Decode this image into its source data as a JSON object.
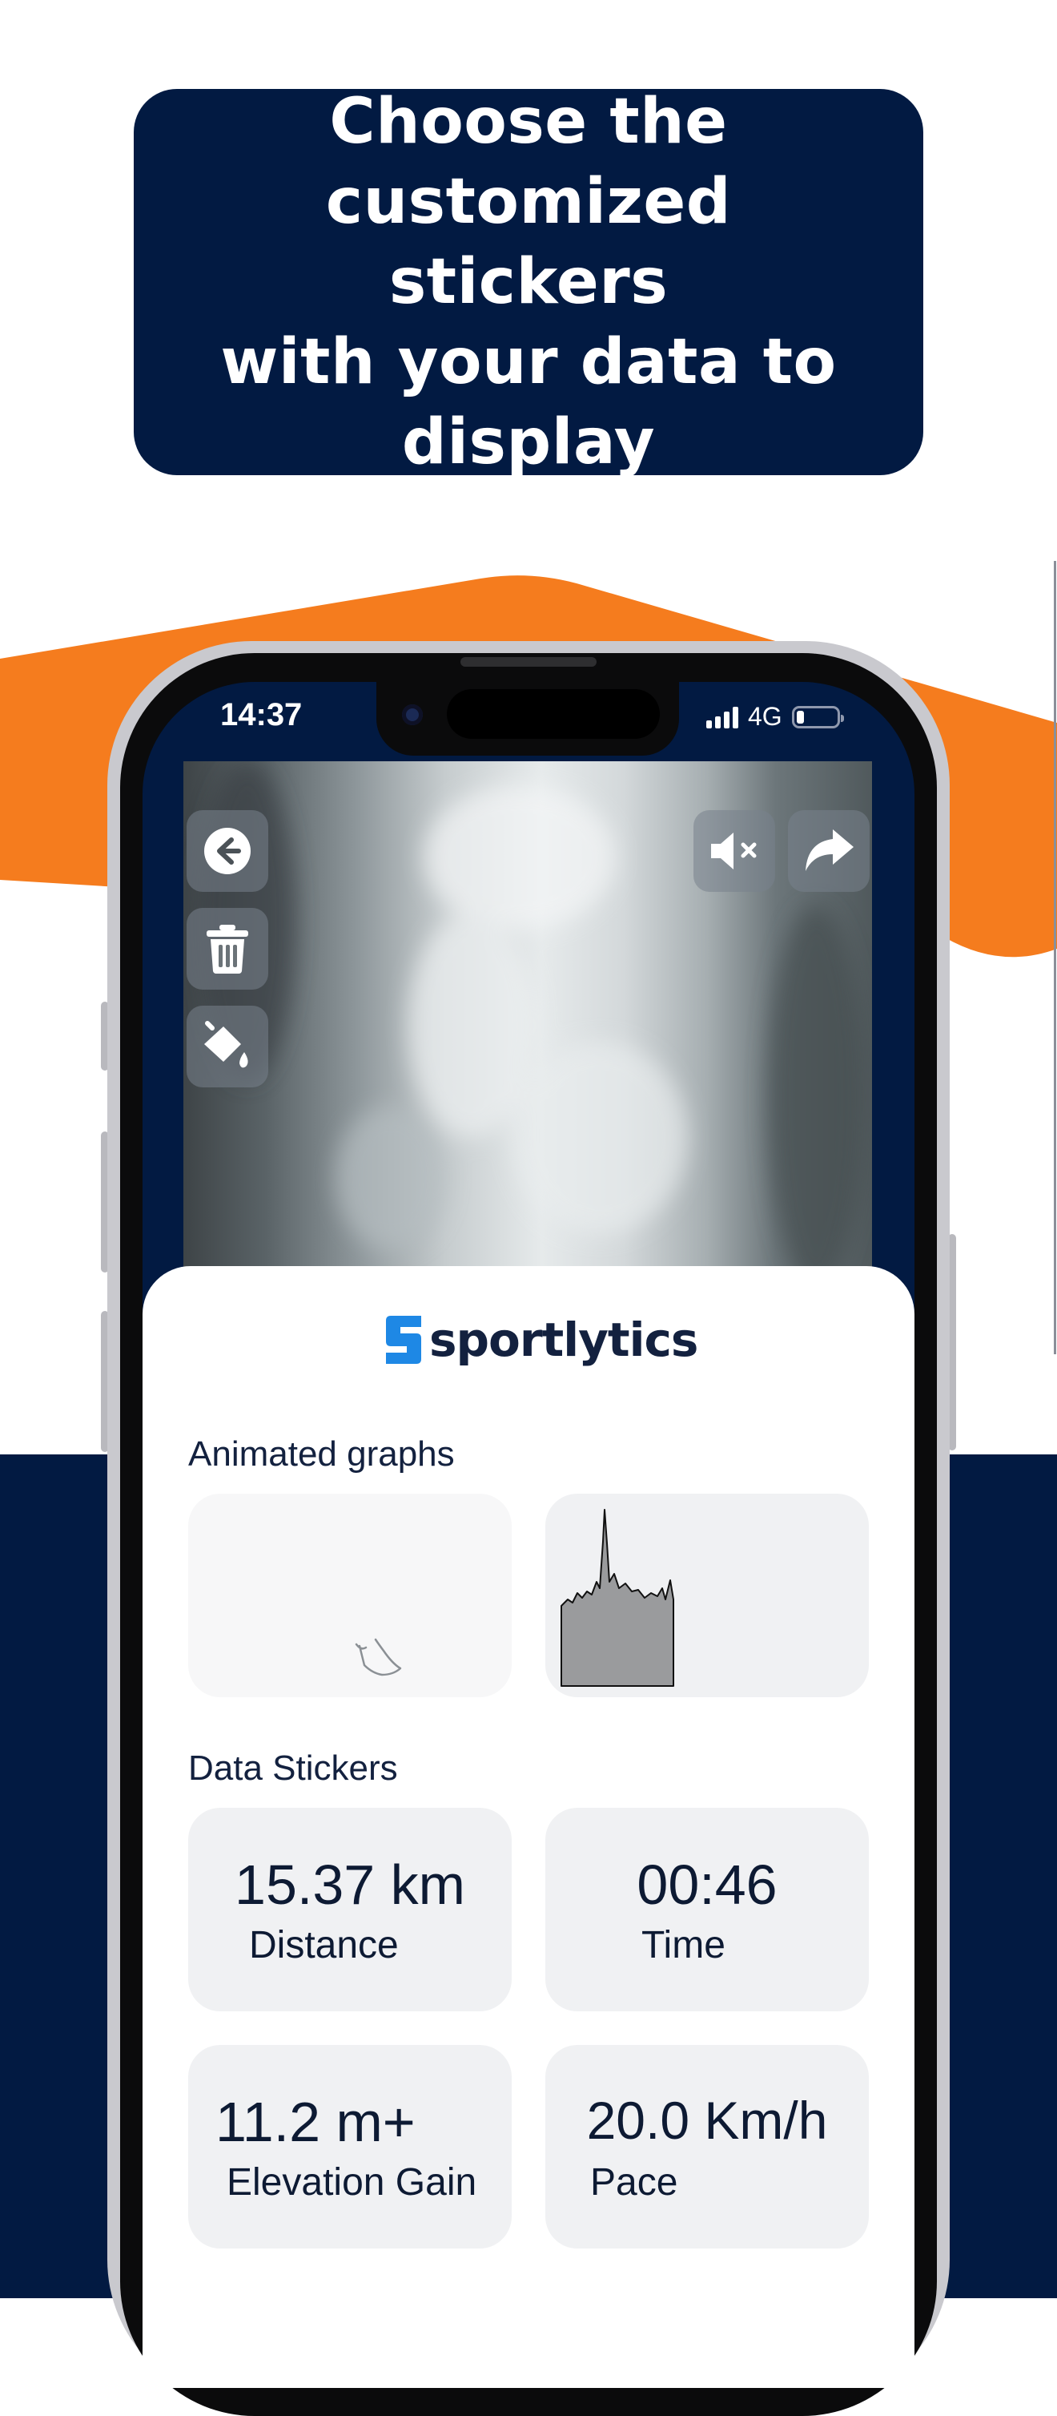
{
  "headline": {
    "lines": [
      "Choose the customized",
      "stickers",
      "with your data to display"
    ]
  },
  "colors": {
    "navy": "#021a42",
    "orange": "#f57c1e",
    "white": "#ffffff",
    "card_bg": "#f0f1f3"
  },
  "status_bar": {
    "time": "14:37",
    "network": "4G",
    "icons": [
      "signal-icon",
      "battery-icon"
    ]
  },
  "video_controls": {
    "left": [
      "back-arrow-icon",
      "trash-icon",
      "paint-bucket-icon"
    ],
    "right": [
      "mute-icon",
      "share-icon"
    ]
  },
  "brand": {
    "name": "sportlytics"
  },
  "sections": {
    "animated_graphs": {
      "label": "Animated graphs"
    },
    "data_stickers": {
      "label": "Data Stickers",
      "items": [
        {
          "value": "15.37 km",
          "label": "Distance"
        },
        {
          "value": "00:46",
          "label": "Time"
        },
        {
          "value": "11.2 m+",
          "label": "Elevation Gain"
        },
        {
          "value": "20.0 Km/h",
          "label": "Pace"
        }
      ]
    }
  }
}
